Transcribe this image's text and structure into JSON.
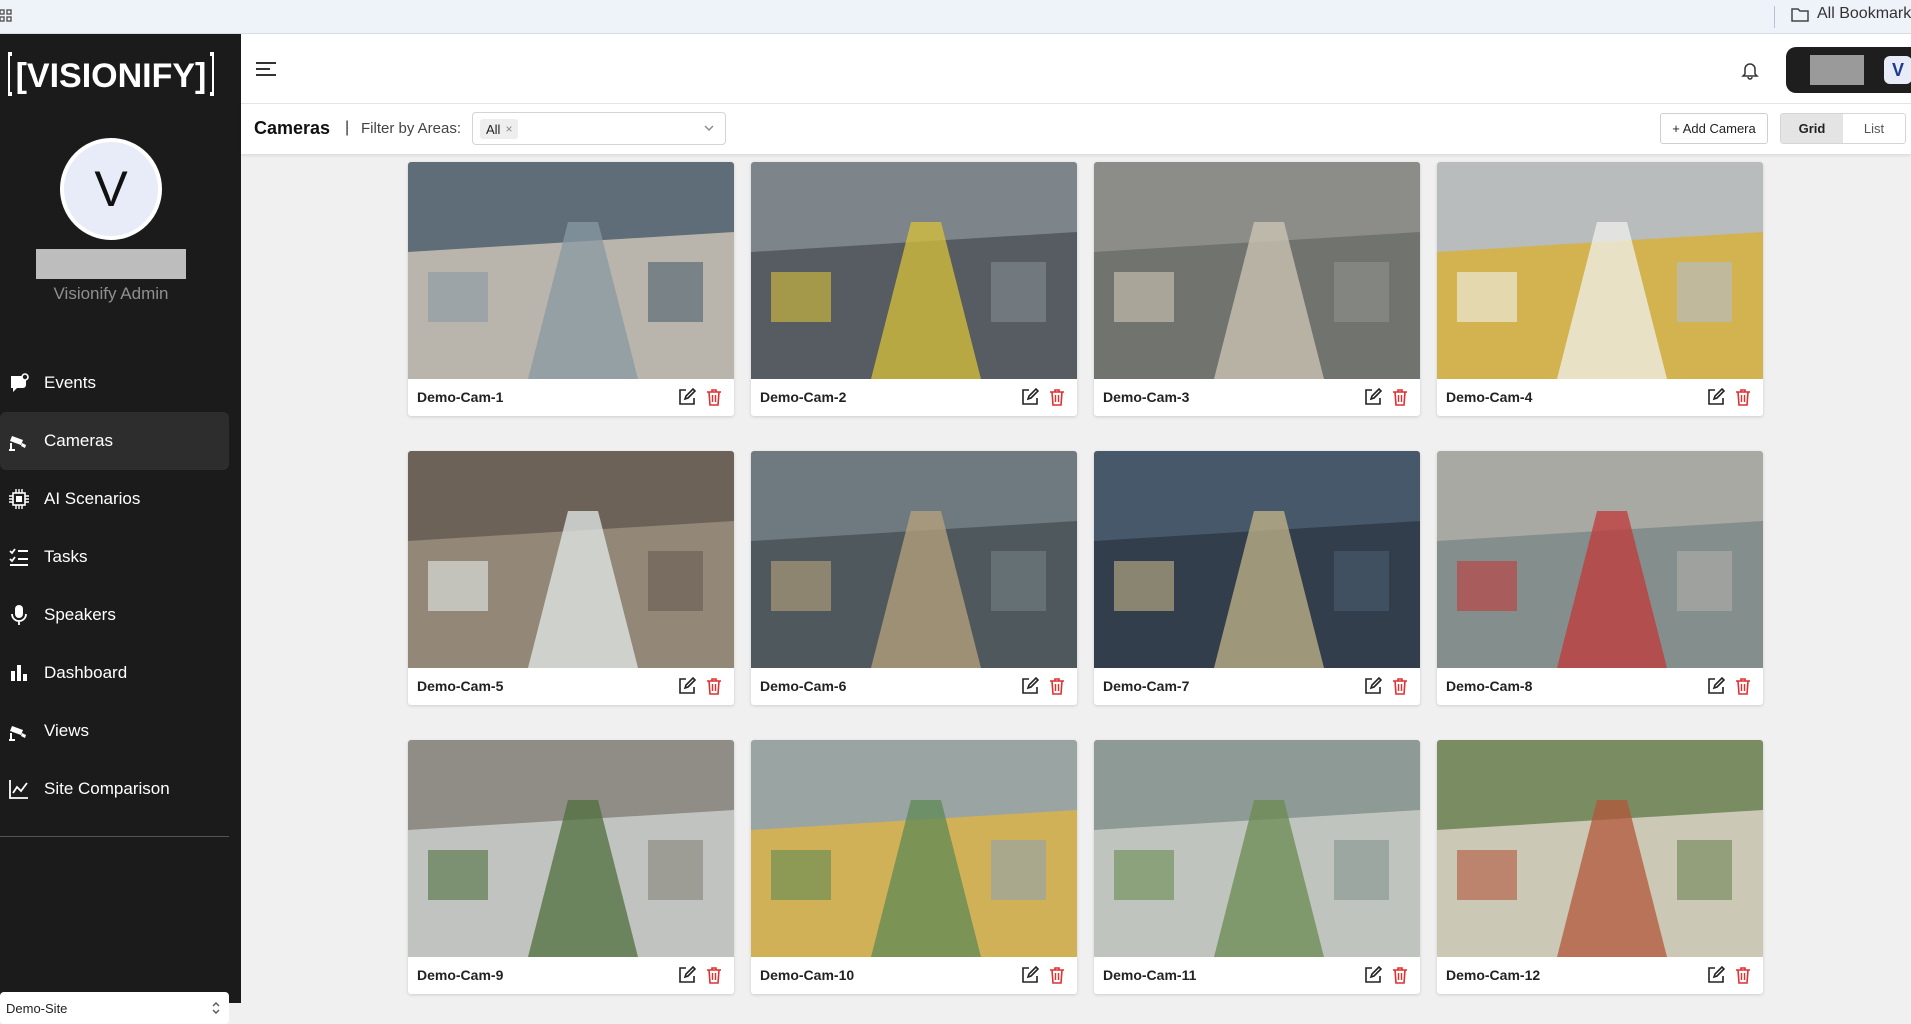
{
  "browser": {
    "bookmarks_label": "All Bookmarks"
  },
  "sidebar": {
    "logo_text": "[VISIONIFY]",
    "avatar_initial": "V",
    "role": "Visionify Admin",
    "items": [
      {
        "label": "Events",
        "icon": "events-icon"
      },
      {
        "label": "Cameras",
        "icon": "camera-icon"
      },
      {
        "label": "AI Scenarios",
        "icon": "chip-icon"
      },
      {
        "label": "Tasks",
        "icon": "tasks-icon"
      },
      {
        "label": "Speakers",
        "icon": "microphone-icon"
      },
      {
        "label": "Dashboard",
        "icon": "bar-chart-icon"
      },
      {
        "label": "Views",
        "icon": "camera-icon"
      },
      {
        "label": "Site Comparison",
        "icon": "line-chart-icon"
      }
    ],
    "site_select": "Demo-Site"
  },
  "header": {
    "profile_initial": "V"
  },
  "toolbar": {
    "title": "Cameras",
    "separator": "|",
    "filter_label": "Filter by Areas:",
    "filter_tag": "All",
    "add_camera": "+ Add Camera",
    "view_grid": "Grid",
    "view_list": "List"
  },
  "cameras": [
    {
      "name": "Demo-Cam-1"
    },
    {
      "name": "Demo-Cam-2"
    },
    {
      "name": "Demo-Cam-3"
    },
    {
      "name": "Demo-Cam-4"
    },
    {
      "name": "Demo-Cam-5"
    },
    {
      "name": "Demo-Cam-6"
    },
    {
      "name": "Demo-Cam-7"
    },
    {
      "name": "Demo-Cam-8"
    },
    {
      "name": "Demo-Cam-9"
    },
    {
      "name": "Demo-Cam-10"
    },
    {
      "name": "Demo-Cam-11"
    },
    {
      "name": "Demo-Cam-12"
    }
  ],
  "colors": {
    "sidebar_bg": "#1b1b1b",
    "active_item": "#2d2d2d",
    "delete_red": "#e03030"
  }
}
